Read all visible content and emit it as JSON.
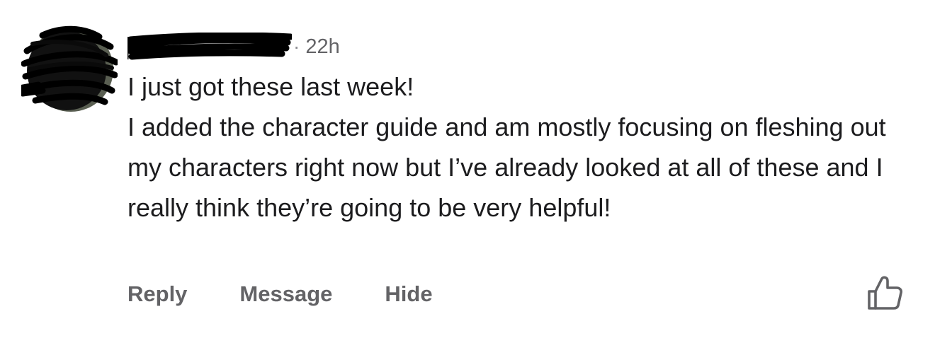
{
  "comment": {
    "author_name": "",
    "separator": "·",
    "timestamp": "22h",
    "first_line": "I just got these last week!",
    "body": "I added the character guide and am mostly focusing on fleshing out my characters right now but I’ve already looked at all of these and I really think they’re going to be very helpful!"
  },
  "actions": {
    "reply_label": "Reply",
    "message_label": "Message",
    "hide_label": "Hide",
    "like_icon": "thumbs-up-icon"
  },
  "colors": {
    "text": "#1c1c1e",
    "secondary_text": "#636366",
    "redaction": "#000000"
  }
}
